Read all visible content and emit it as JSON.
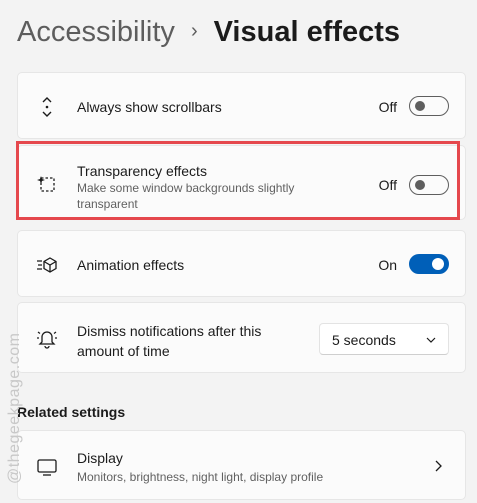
{
  "breadcrumb": {
    "parent": "Accessibility",
    "separator": "›",
    "current": "Visual effects"
  },
  "settings": [
    {
      "title": "Always show scrollbars",
      "state": "Off",
      "on": false,
      "icon": "scrollbar-arrows-icon"
    },
    {
      "title": "Transparency effects",
      "subtitle": "Make some window backgrounds slightly transparent",
      "state": "Off",
      "on": false,
      "icon": "transparency-icon"
    },
    {
      "title": "Animation effects",
      "state": "On",
      "on": true,
      "icon": "animation-icon"
    },
    {
      "title": "Dismiss notifications after this amount of time",
      "dropdown_value": "5 seconds",
      "icon": "bell-icon"
    }
  ],
  "related": {
    "heading": "Related settings",
    "display": {
      "title": "Display",
      "subtitle": "Monitors, brightness, night light, display profile",
      "icon": "monitor-icon"
    }
  },
  "watermark": "@thegeekpage.com",
  "colors": {
    "accent": "#005fb8",
    "highlight": "#e5484d"
  }
}
